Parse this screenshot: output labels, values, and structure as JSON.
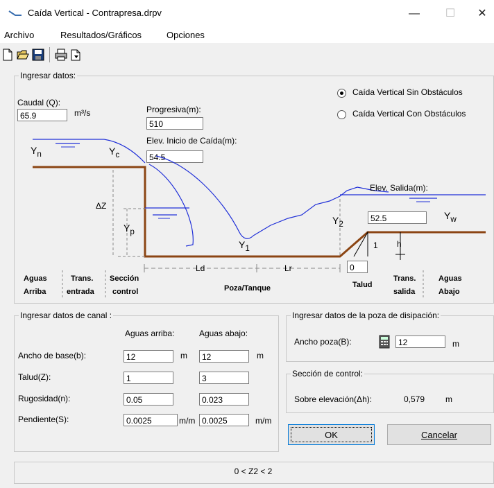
{
  "window": {
    "title": "Caída Vertical - Contrapresa.drpv",
    "minimize": "—",
    "maximize": "☐",
    "close": "✕"
  },
  "menu": [
    "Archivo",
    "Resultados/Gráficos",
    "Opciones"
  ],
  "input_group": {
    "legend": "Ingresar datos:",
    "caudal_label": "Caudal (Q):",
    "caudal_value": "65.9",
    "caudal_unit": "m³/s",
    "progresiva_label": "Progresiva(m):",
    "progresiva_value": "510",
    "elev_inicio_label": "Elev. Inicio de Caída(m):",
    "elev_inicio_value": "54.5",
    "radio1": "Caída Vertical Sin Obstáculos",
    "radio2": "Caída Vertical Con Obstáculos",
    "elev_salida_label": "Elev. Salida(m):",
    "elev_salida_value": "52.5",
    "talud_value": "0"
  },
  "diagram": {
    "yn": "Y",
    "yn_sub": "n",
    "yc": "Y",
    "yc_sub": "c",
    "yw": "Y",
    "yw_sub": "w",
    "yp": "Y",
    "yp_sub": "p",
    "y1": "Y",
    "y1_sub": "1",
    "y2": "Y",
    "y2_sub": "2",
    "dz": "ΔZ",
    "ld": "Ld",
    "lr": "Lr",
    "h": "h",
    "one": "1",
    "zones": {
      "aguas_arriba_1": "Aguas",
      "aguas_arriba_2": "Arriba",
      "trans_entrada_1": "Trans.",
      "trans_entrada_2": "entrada",
      "seccion_control_1": "Sección",
      "seccion_control_2": "control",
      "poza": "Poza/Tanque",
      "talud": "Talud",
      "trans_salida_1": "Trans.",
      "trans_salida_2": "salida",
      "aguas_abajo_1": "Aguas",
      "aguas_abajo_2": "Abajo"
    }
  },
  "canal_group": {
    "legend": "Ingresar datos de canal :",
    "col_arriba": "Aguas arriba:",
    "col_abajo": "Aguas abajo:",
    "rows": [
      {
        "label": "Ancho de base(b):",
        "arriba": "12",
        "abajo": "12",
        "unit1": "m",
        "unit2": "m"
      },
      {
        "label": "Talud(Z):",
        "arriba": "1",
        "abajo": "3",
        "unit1": "",
        "unit2": ""
      },
      {
        "label": "Rugosidad(n):",
        "arriba": "0.05",
        "abajo": "0.023",
        "unit1": "",
        "unit2": ""
      },
      {
        "label": "Pendiente(S):",
        "arriba": "0.0025",
        "abajo": "0.0025",
        "unit1": "m/m",
        "unit2": "m/m"
      }
    ]
  },
  "poza_group": {
    "legend": "Ingresar datos de la poza de disipación:",
    "ancho_label": "Ancho poza(B):",
    "ancho_value": "12",
    "unit": "m"
  },
  "control_group": {
    "legend": "Sección de control:",
    "label": "Sobre elevación(Δh):",
    "value": "0,579",
    "unit": "m"
  },
  "buttons": {
    "ok": "OK",
    "cancel": "Cancelar"
  },
  "status": "0 < Z2 < 2"
}
